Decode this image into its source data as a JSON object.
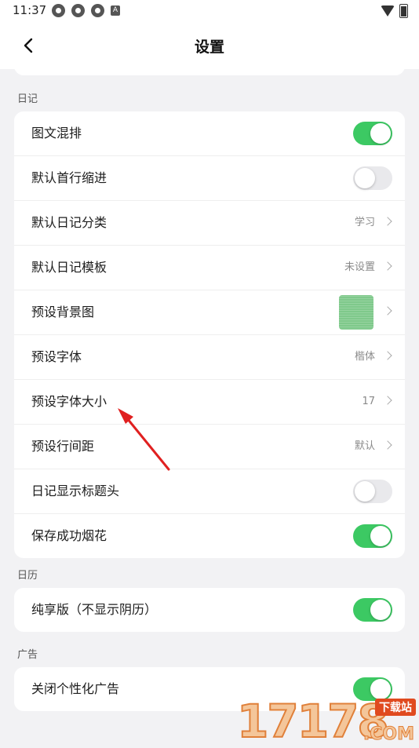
{
  "status_bar": {
    "time": "11:37"
  },
  "header": {
    "title": "设置"
  },
  "sections": [
    {
      "label": "日记",
      "rows": [
        {
          "label": "图文混排",
          "type": "toggle",
          "on": true
        },
        {
          "label": "默认首行缩进",
          "type": "toggle",
          "on": false
        },
        {
          "label": "默认日记分类",
          "type": "value",
          "value": "学习"
        },
        {
          "label": "默认日记模板",
          "type": "value",
          "value": "未设置"
        },
        {
          "label": "预设背景图",
          "type": "image"
        },
        {
          "label": "预设字体",
          "type": "value",
          "value": "楷体"
        },
        {
          "label": "预设字体大小",
          "type": "value",
          "value": "17"
        },
        {
          "label": "预设行间距",
          "type": "value",
          "value": "默认"
        },
        {
          "label": "日记显示标题头",
          "type": "toggle",
          "on": false
        },
        {
          "label": "保存成功烟花",
          "type": "toggle",
          "on": true
        }
      ]
    },
    {
      "label": "日历",
      "rows": [
        {
          "label": "纯享版（不显示阴历）",
          "type": "toggle",
          "on": true
        }
      ]
    },
    {
      "label": "广告",
      "rows": [
        {
          "label": "关闭个性化广告",
          "type": "toggle",
          "on": true
        }
      ]
    }
  ],
  "colors": {
    "toggle_on": "#3cc963",
    "toggle_off": "#e9e9ec",
    "annotation_arrow": "#e02020"
  },
  "watermark": {
    "number": "17178",
    "badge": "下载站",
    "suffix": ".COM"
  }
}
